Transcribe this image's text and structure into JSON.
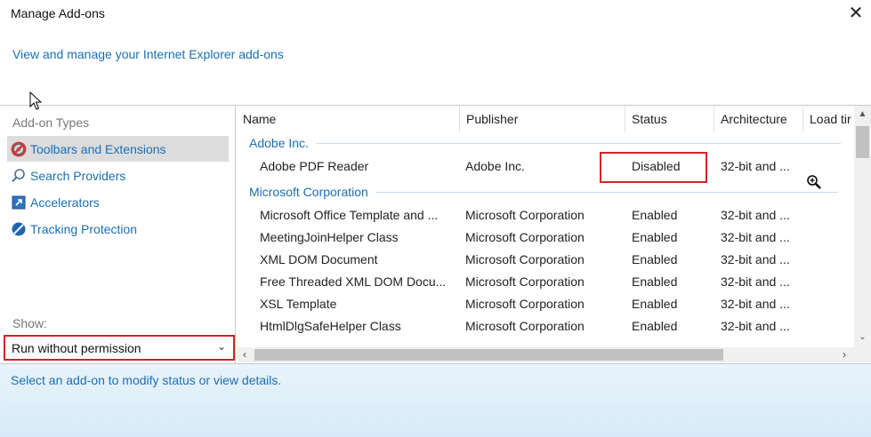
{
  "window": {
    "title": "Manage Add-ons",
    "close_glyph": "✕",
    "intro_link": "View and manage your Internet Explorer add-ons"
  },
  "left_pane": {
    "types_label": "Add-on Types",
    "types": [
      {
        "label": "Toolbars and Extensions",
        "icon": "toolbars-extensions-icon",
        "selected": true
      },
      {
        "label": "Search Providers",
        "icon": "search-icon",
        "selected": false
      },
      {
        "label": "Accelerators",
        "icon": "accelerator-icon",
        "selected": false
      },
      {
        "label": "Tracking Protection",
        "icon": "tracking-protection-icon",
        "selected": false
      }
    ],
    "show_label": "Show:",
    "show_value": "Run without permission"
  },
  "table": {
    "columns": [
      "Name",
      "Publisher",
      "Status",
      "Architecture",
      "Load tir"
    ],
    "groups": [
      {
        "name": "Adobe Inc.",
        "rows": [
          {
            "name": "Adobe PDF Reader",
            "publisher": "Adobe Inc.",
            "status": "Disabled",
            "arch": "32-bit and ..."
          }
        ]
      },
      {
        "name": "Microsoft Corporation",
        "rows": [
          {
            "name": "Microsoft Office Template and ...",
            "publisher": "Microsoft Corporation",
            "status": "Enabled",
            "arch": "32-bit and ..."
          },
          {
            "name": "MeetingJoinHelper Class",
            "publisher": "Microsoft Corporation",
            "status": "Enabled",
            "arch": "32-bit and ..."
          },
          {
            "name": "XML DOM Document",
            "publisher": "Microsoft Corporation",
            "status": "Enabled",
            "arch": "32-bit and ..."
          },
          {
            "name": "Free Threaded XML DOM Docu...",
            "publisher": "Microsoft Corporation",
            "status": "Enabled",
            "arch": "32-bit and ..."
          },
          {
            "name": "XSL Template",
            "publisher": "Microsoft Corporation",
            "status": "Enabled",
            "arch": "32-bit and ..."
          },
          {
            "name": "HtmlDlgSafeHelper Class",
            "publisher": "Microsoft Corporation",
            "status": "Enabled",
            "arch": "32-bit and ..."
          }
        ]
      }
    ]
  },
  "details": {
    "text": "Select an add-on to modify status or view details."
  },
  "colors": {
    "link": "#1a6fb5",
    "highlight_border": "#d02525",
    "selected_bg": "#dcdcdc"
  }
}
